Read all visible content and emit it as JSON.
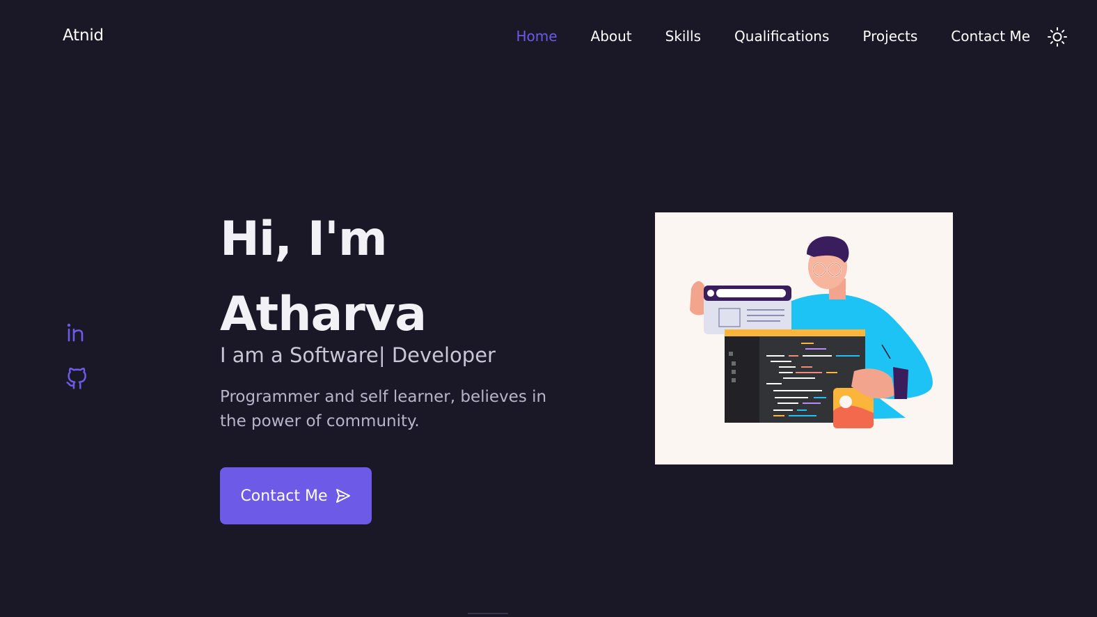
{
  "header": {
    "logo": "Atnid",
    "nav": [
      {
        "label": "Home",
        "active": true
      },
      {
        "label": "About",
        "active": false
      },
      {
        "label": "Skills",
        "active": false
      },
      {
        "label": "Qualifications",
        "active": false
      },
      {
        "label": "Projects",
        "active": false
      },
      {
        "label": "Contact Me",
        "active": false
      }
    ],
    "theme_icon": "sun-icon"
  },
  "social": [
    {
      "icon": "linkedin-icon"
    },
    {
      "icon": "github-icon"
    }
  ],
  "hero": {
    "title_line1": "Hi, I'm",
    "title_line2": "Atharva",
    "subtitle": "I am a Software| Developer",
    "description": "Programmer and self learner, believes in the power of community.",
    "cta_label": "Contact Me",
    "cta_icon": "send-icon"
  },
  "colors": {
    "background": "#1a1727",
    "accent": "#6d5ae6",
    "text": "#ffffff"
  }
}
